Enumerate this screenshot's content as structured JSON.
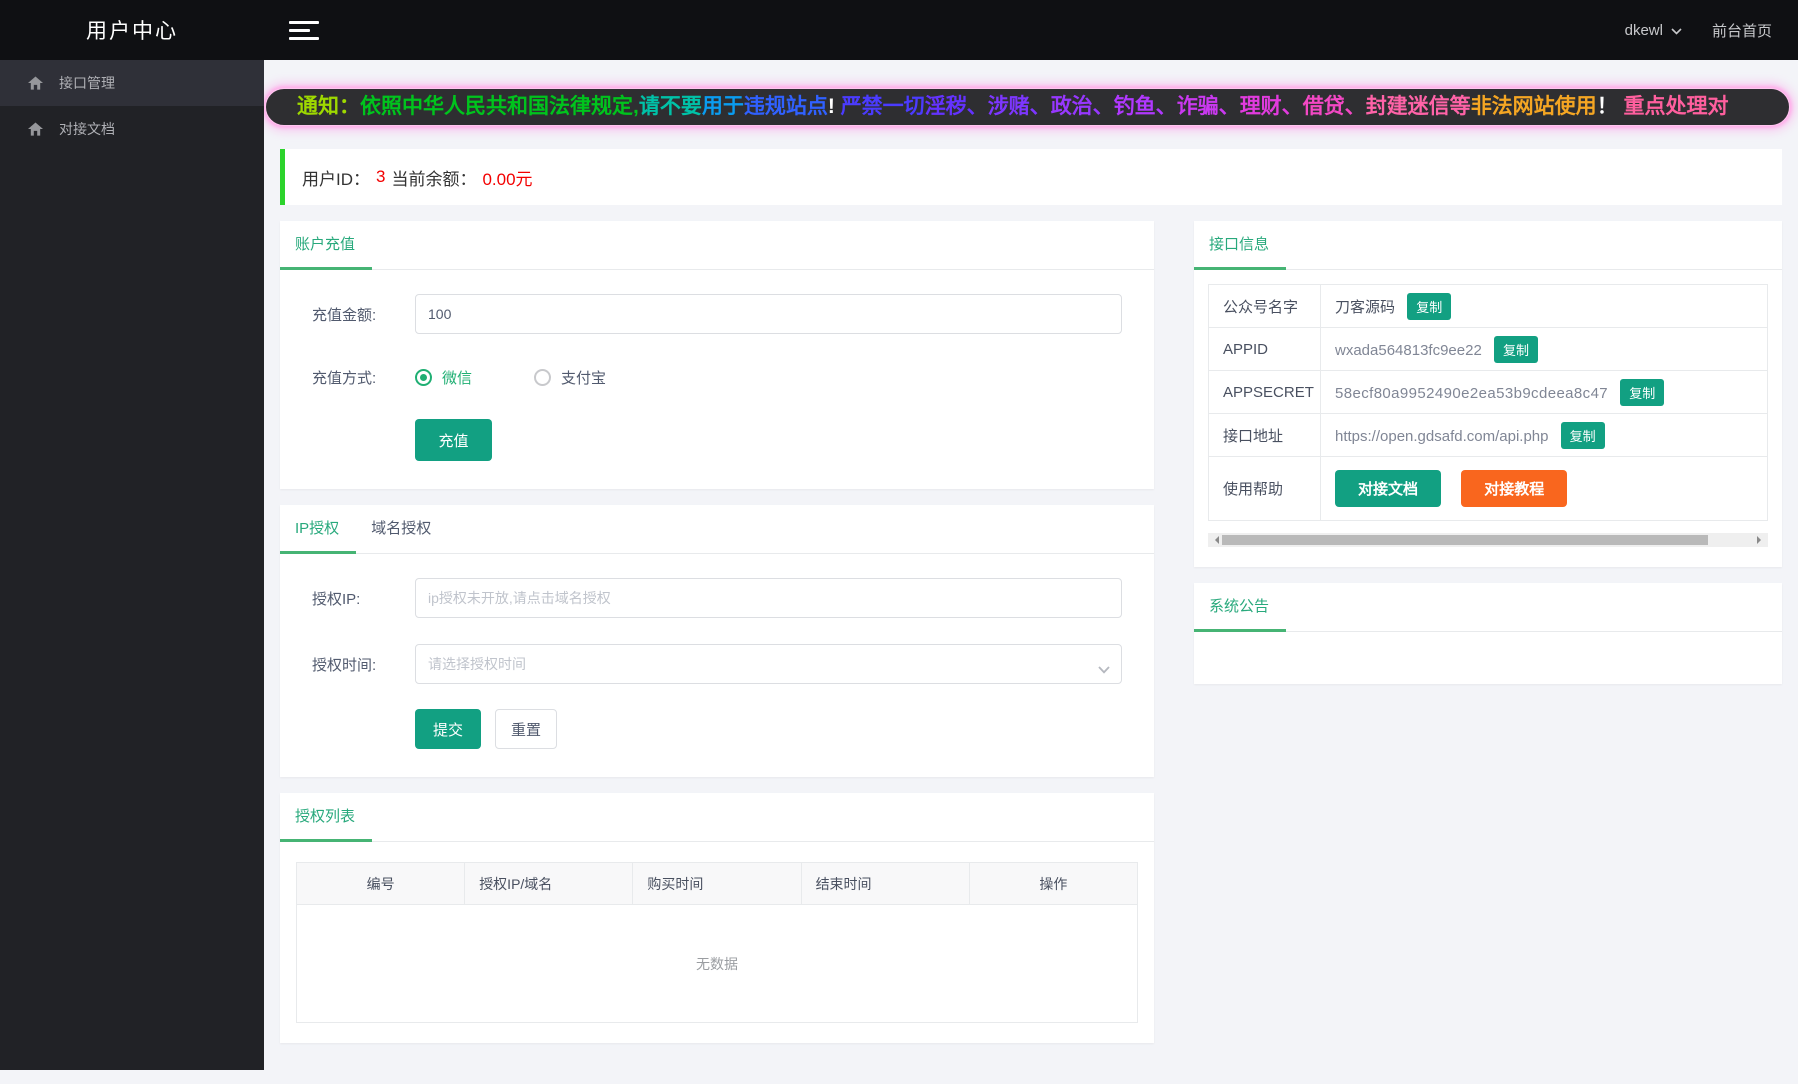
{
  "header": {
    "logo": "用户中心",
    "username": "dkewl",
    "front_link": "前台首页"
  },
  "sidebar": {
    "items": [
      {
        "label": "接口管理"
      },
      {
        "label": "对接文档"
      }
    ]
  },
  "notice": {
    "segments": [
      {
        "text": "通知：",
        "color": "#9ed900"
      },
      {
        "text": "依照中华人民共和国法律规定,",
        "color": "#00c41d"
      },
      {
        "text": "请不要",
        "color": "#00c2a8"
      },
      {
        "text": "用于",
        "color": "#0a9cf0"
      },
      {
        "text": "违规站点",
        "color": "#3061ff"
      },
      {
        "text": "!",
        "color": "#ffffff"
      },
      {
        "text": " 严禁一切",
        "color": "#4b3bff"
      },
      {
        "text": "淫秽、",
        "color": "#6432ff"
      },
      {
        "text": "涉赌、",
        "color": "#7d36ff"
      },
      {
        "text": "政治、",
        "color": "#9737ff"
      },
      {
        "text": "钓鱼、",
        "color": "#b138ff"
      },
      {
        "text": "诈骗、",
        "color": "#ca39f0"
      },
      {
        "text": "理财、",
        "color": "#e13bde"
      },
      {
        "text": "借贷、",
        "color": "#f348c4"
      },
      {
        "text": "封建迷信等",
        "color": "#ff63a8"
      },
      {
        "text": "非法网站使用",
        "color": "#f5a623"
      },
      {
        "text": "！ ",
        "color": "#ffffff"
      },
      {
        "text": "重点处理对",
        "color": "#ff5f9e"
      }
    ]
  },
  "userbar": {
    "id_label": "用户ID：",
    "id_value": "3",
    "balance_label": "当前余额：",
    "balance_value": "0.00元"
  },
  "recharge": {
    "tab": "账户充值",
    "amount_label": "充值金额:",
    "amount_value": "100",
    "method_label": "充值方式:",
    "methods": [
      {
        "label": "微信",
        "selected": true
      },
      {
        "label": "支付宝",
        "selected": false
      }
    ],
    "submit_label": "充值"
  },
  "auth": {
    "tabs": [
      "IP授权",
      "域名授权"
    ],
    "ip_label": "授权IP:",
    "ip_placeholder": "ip授权未开放,请点击域名授权",
    "time_label": "授权时间:",
    "time_placeholder": "请选择授权时间",
    "submit_label": "提交",
    "reset_label": "重置"
  },
  "auth_table": {
    "tab": "授权列表",
    "headers": [
      "编号",
      "授权IP/域名",
      "购买时间",
      "结束时间",
      "操作"
    ],
    "empty_text": "无数据"
  },
  "api_info": {
    "tab": "接口信息",
    "rows": [
      {
        "label": "公众号名字",
        "value": "刀客源码",
        "copy": "复制"
      },
      {
        "label": "APPID",
        "value": "wxada564813fc9ee22",
        "copy": "复制"
      },
      {
        "label": "APPSECRET",
        "value": "58ecf80a9952490e2ea53b9cdeea8c47",
        "copy": "复制"
      },
      {
        "label": "接口地址",
        "value": "https://open.gdsafd.com/api.php",
        "copy": "复制"
      },
      {
        "label": "使用帮助",
        "buttons": [
          {
            "label": "对接文档"
          },
          {
            "label": "对接教程"
          }
        ]
      }
    ]
  },
  "announcement": {
    "tab": "系统公告"
  },
  "colors": {
    "topbar_bg": "#0f1013",
    "sidebar_bg": "#212226",
    "accent_teal": "#12a082",
    "tab_green": "#28a97c",
    "underline_green": "#46b474",
    "radio_green": "#1faf73",
    "danger_red": "#f30000",
    "orange": "#f9661e",
    "userbar_green": "#2cd32c",
    "banner_glow": "#ffaeea",
    "banner_bg": "#2e2e31"
  }
}
